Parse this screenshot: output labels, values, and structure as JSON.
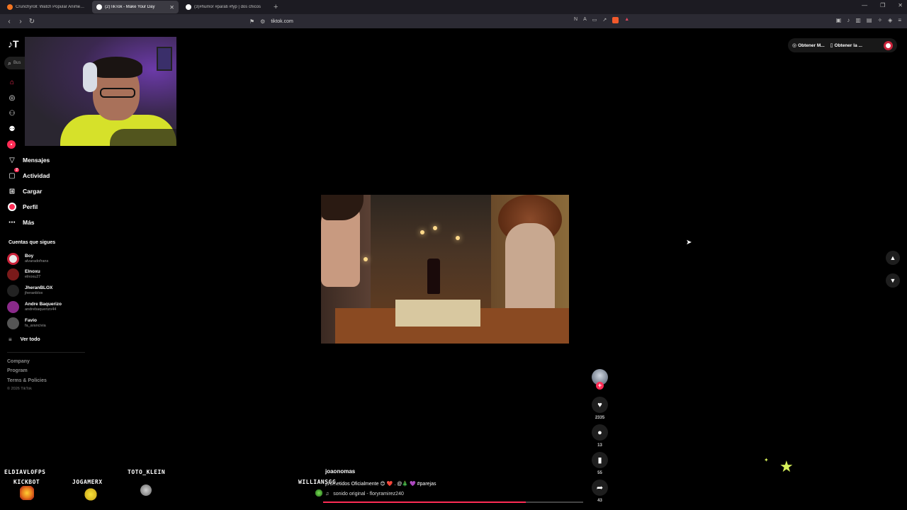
{
  "browser": {
    "tabs": [
      {
        "title": "Crunchyroll: Watch Popular Anime, P",
        "favicon_color": "#f47521",
        "active": false
      },
      {
        "title": "(2)TikTok - Make Your Day",
        "favicon_color": "#ffffff",
        "active": true
      },
      {
        "title": "(3)#humor #parati #fyp | dos chicos",
        "favicon_color": "#ffffff",
        "active": false
      }
    ],
    "url": "tiktok.com"
  },
  "sidebar": {
    "search_placeholder": "Bus",
    "nav": [
      {
        "label": "Mensajes",
        "icon": "send-icon"
      },
      {
        "label": "Actividad",
        "icon": "inbox-icon",
        "badge": "2"
      },
      {
        "label": "Cargar",
        "icon": "upload-icon"
      },
      {
        "label": "Perfil",
        "icon": "profile-icon"
      },
      {
        "label": "Más",
        "icon": "more-icon"
      }
    ],
    "following_title": "Cuentas que sigues",
    "following": [
      {
        "name": "Boy",
        "username": "alvaradofrans",
        "color": "#e8e8e8"
      },
      {
        "name": "Elnoxu",
        "username": "elnoxu27",
        "color": "#7a1a1a"
      },
      {
        "name": "JheranBLOX",
        "username": "jheranblox",
        "color": "#222222"
      },
      {
        "name": "Andre Baquerizo",
        "username": "andrebaquerizo44",
        "color": "#8a2a8a"
      },
      {
        "name": "Favio",
        "username": "fa_arancivia",
        "color": "#555555"
      }
    ],
    "see_all": "Ver todo",
    "footer_links": [
      "Company",
      "Program",
      "Terms & Policies"
    ],
    "copyright": "© 2026 TikTok"
  },
  "top_right": {
    "get_coins": "Obtener M...",
    "get_app": "Obtener la ..."
  },
  "video": {
    "author": "joaonomas",
    "description": "prometidos Oficialmente 😊 ❤️ . @🎄 💜 #parejas",
    "sound": "sonido original - floryramirez240",
    "likes": "2335",
    "comments": "13",
    "saves": "55",
    "shares": "43",
    "progress": 0.78
  },
  "stream_overlay": {
    "labels": [
      "ELDIAVLOFPS",
      "KICKBOT",
      "JOGAMERX",
      "TOTO_KLEIN",
      "WILLIANSGG"
    ]
  }
}
